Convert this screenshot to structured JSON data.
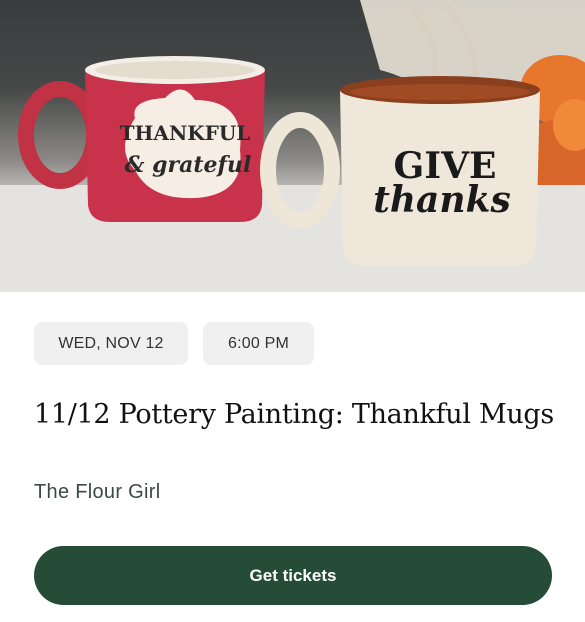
{
  "event": {
    "image_alt": "Two mugs reading Thankful & grateful and Give thanks",
    "mug_left_text": [
      "THANKFUL",
      "& grateful"
    ],
    "mug_right_text": [
      "GIVE",
      "thanks"
    ],
    "date": "WED, NOV 12",
    "time": "6:00 PM",
    "title": "11/12 Pottery Painting: Thankful Mugs",
    "venue": "The Flour Girl",
    "cta_label": "Get tickets"
  },
  "colors": {
    "cta_bg": "#244c37",
    "chip_bg": "#f0f0f0",
    "venue_text": "#3b4a43"
  }
}
